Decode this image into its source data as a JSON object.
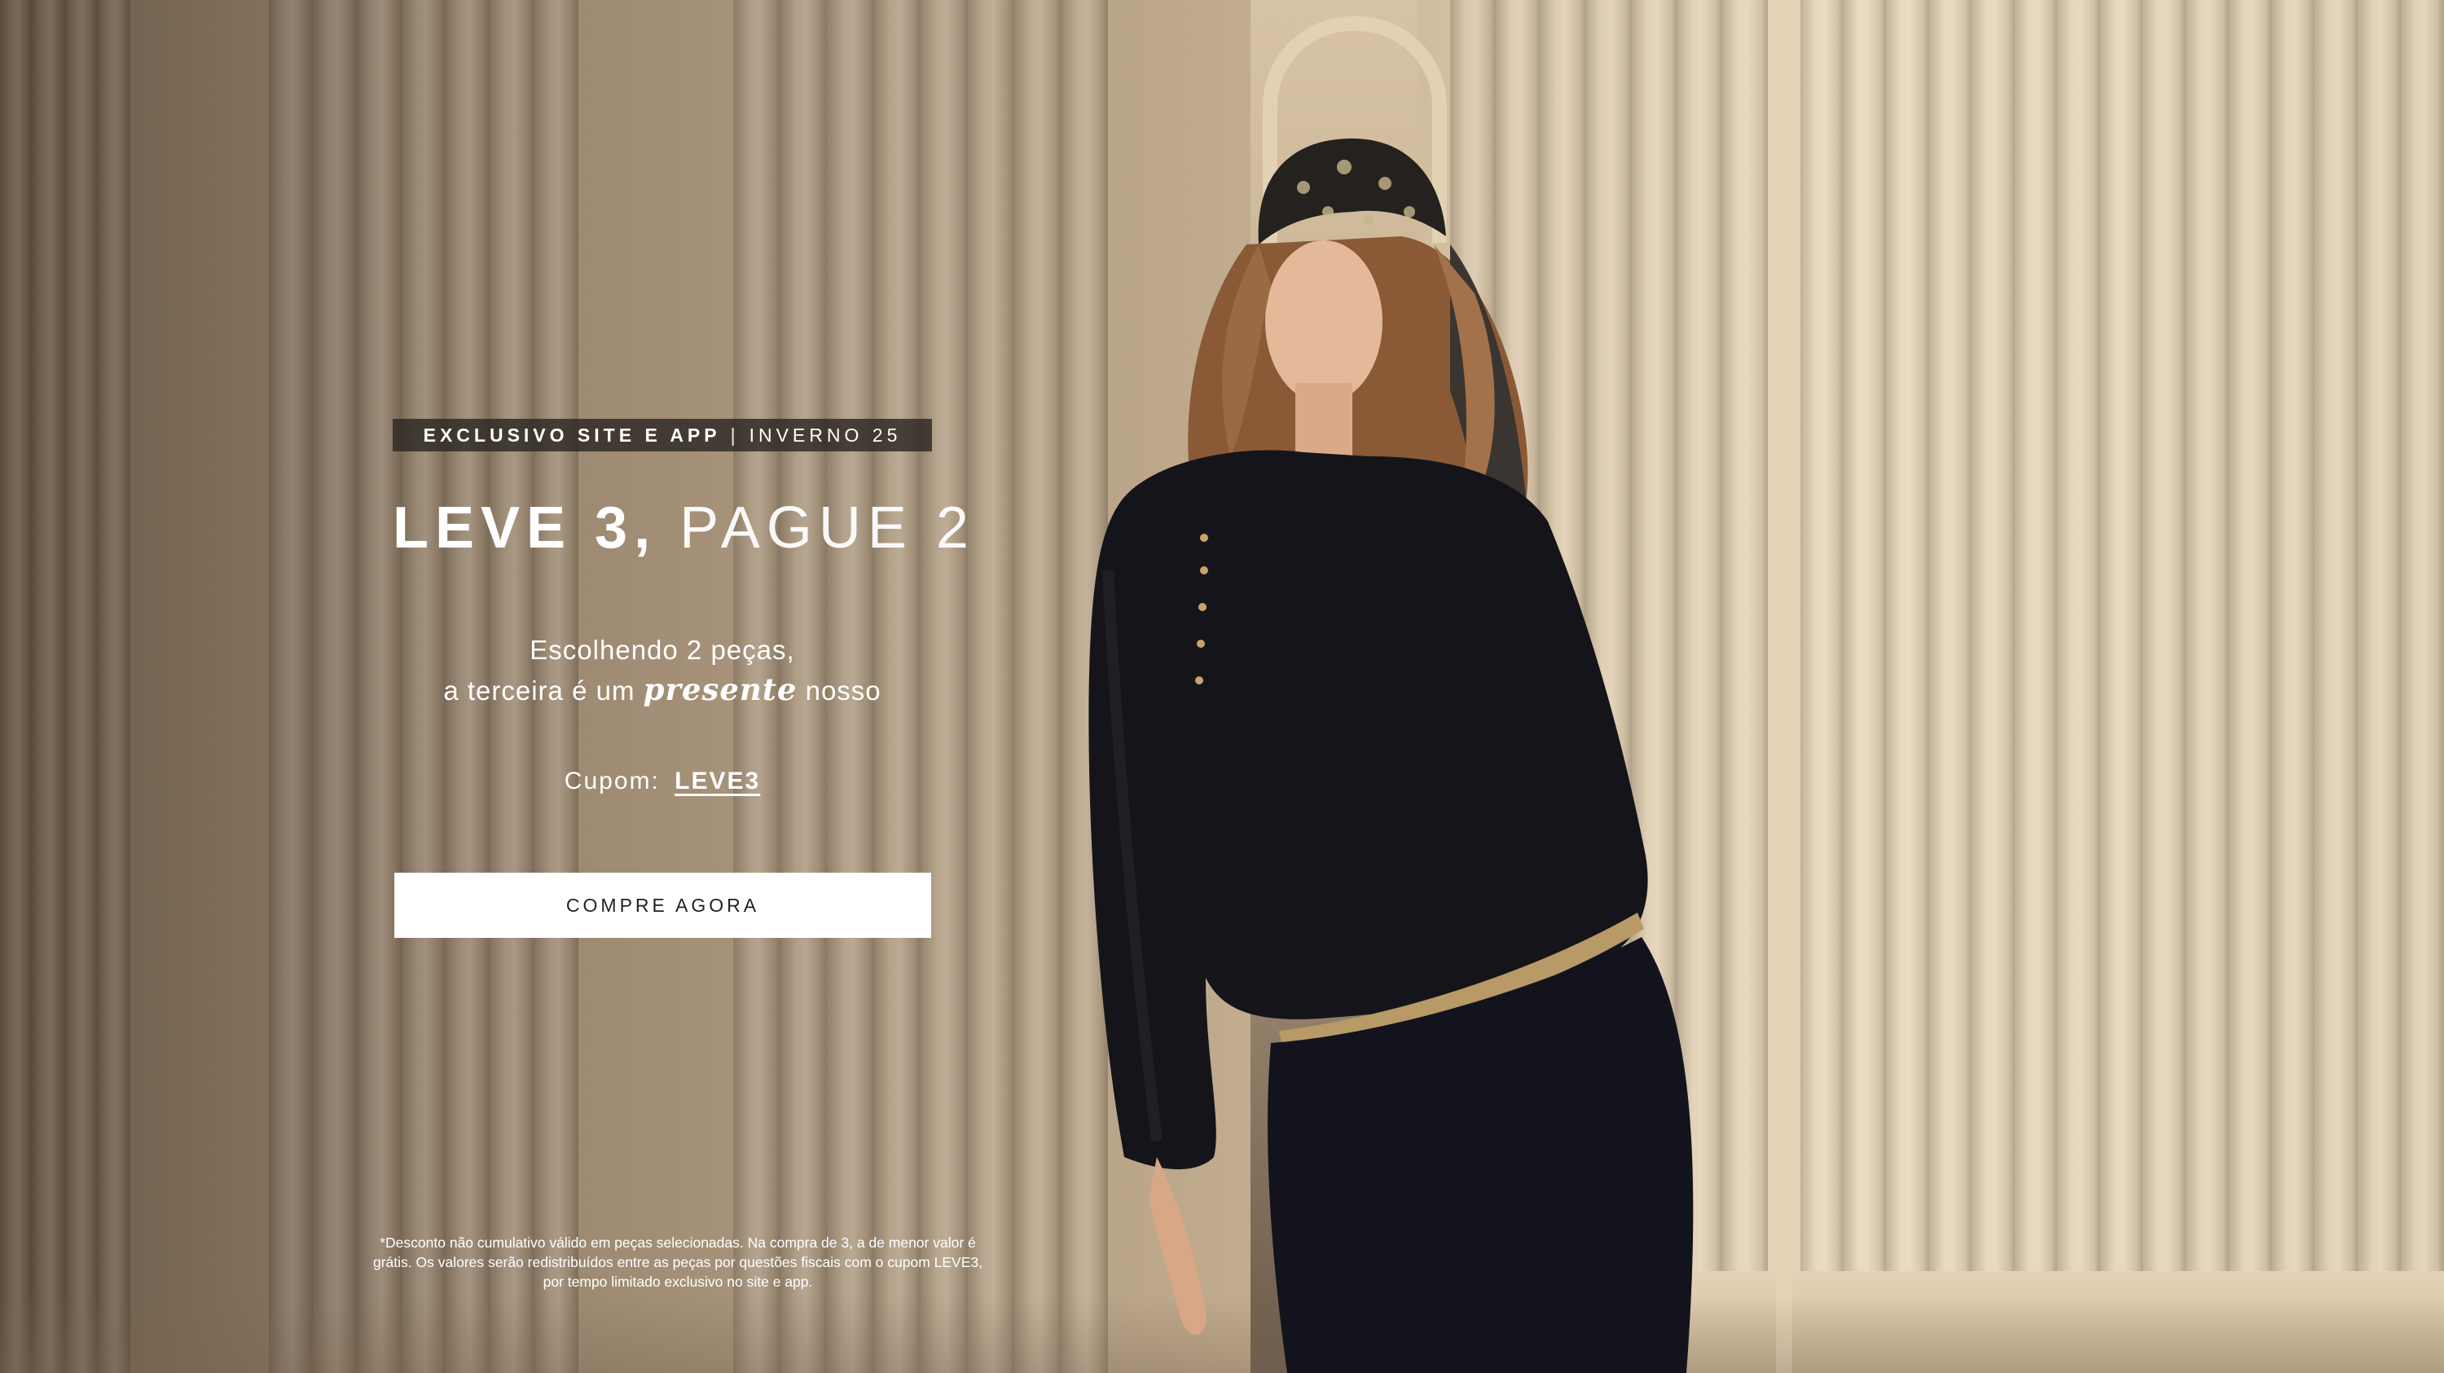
{
  "promo": {
    "tagline_strong": "EXCLUSIVO SITE E APP",
    "tagline_separator": "|",
    "tagline_light": "INVERNO 25",
    "headline_bold": "LEVE 3,",
    "headline_thin": "PAGUE 2",
    "subtitle_line1": "Escolhendo 2 peças,",
    "subtitle_line2_start": "a terceira é um",
    "subtitle_line2_emphasis": "presente",
    "subtitle_line2_end": "nosso",
    "coupon_label": "Cupom:",
    "coupon_code": "LEVE3",
    "cta_label": "COMPRE AGORA",
    "disclaimer": "*Desconto não cumulativo válido em peças selecionadas. Na compra de 3, a de menor valor é grátis. Os valores serão redistribuídos entre as peças por questões fiscais com o cupom LEVE3, por tempo limitado exclusivo no site e app."
  },
  "colors": {
    "text": "#ffffff",
    "tagline_bg": "#2d2824",
    "cta_bg": "#ffffff",
    "cta_text": "#222222"
  }
}
